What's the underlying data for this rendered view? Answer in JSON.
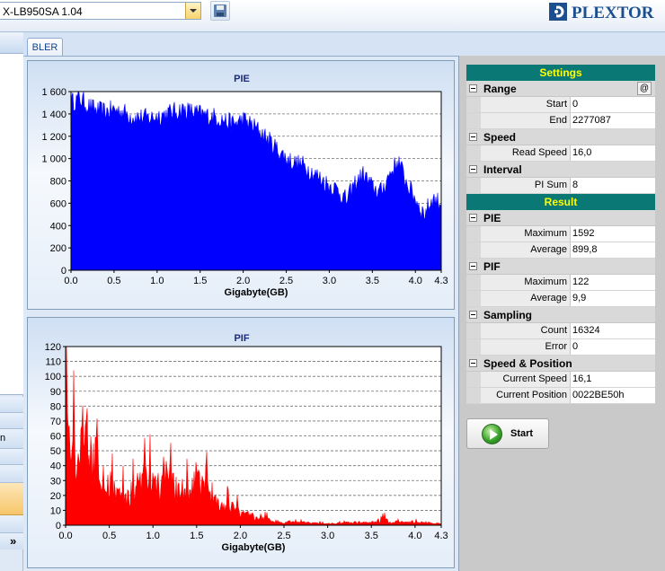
{
  "toolbar": {
    "drive_value": "X-LB950SA 1.04",
    "save_icon": "floppy-disk-icon",
    "brand_text": "PLEXTOR"
  },
  "left_strip": {
    "item_fragment": "n",
    "expand_icon": "double-chevron-right-icon"
  },
  "tabs": [
    {
      "label": "BLER"
    }
  ],
  "charts": {
    "pie_title": "PIE",
    "pif_title": "PIF"
  },
  "chart_data": [
    {
      "type": "area",
      "title": "PIE",
      "xlabel": "Gigabyte(GB)",
      "ylabel": "",
      "xlim": [
        0,
        4.3
      ],
      "ylim": [
        0,
        1600
      ],
      "x_ticks": [
        "0.0",
        "0.5",
        "1.0",
        "1.5",
        "2.0",
        "2.5",
        "3.0",
        "3.5",
        "4.0",
        "4.3"
      ],
      "y_ticks": [
        "0",
        "200",
        "400",
        "600",
        "800",
        "1 000",
        "1 200",
        "1 400",
        "1 600"
      ],
      "x_tick_values": [
        0,
        0.5,
        1.0,
        1.5,
        2.0,
        2.5,
        3.0,
        3.5,
        4.0,
        4.3
      ],
      "y_tick_values": [
        0,
        200,
        400,
        600,
        800,
        1000,
        1200,
        1400,
        1600
      ],
      "grid": "horizontal-dashed",
      "color": "#0000ff",
      "x": [
        0,
        0.1,
        0.2,
        0.3,
        0.4,
        0.5,
        0.6,
        0.7,
        0.8,
        0.9,
        1.0,
        1.1,
        1.2,
        1.3,
        1.4,
        1.5,
        1.6,
        1.7,
        1.8,
        1.9,
        2.0,
        2.1,
        2.2,
        2.3,
        2.4,
        2.5,
        2.6,
        2.7,
        2.8,
        2.9,
        3.0,
        3.1,
        3.2,
        3.3,
        3.4,
        3.5,
        3.6,
        3.7,
        3.8,
        3.9,
        4.0,
        4.1,
        4.2,
        4.3
      ],
      "y": [
        1500,
        1540,
        1470,
        1430,
        1420,
        1440,
        1420,
        1380,
        1370,
        1360,
        1380,
        1400,
        1420,
        1440,
        1420,
        1400,
        1380,
        1370,
        1330,
        1310,
        1350,
        1300,
        1240,
        1160,
        1080,
        1000,
        960,
        940,
        880,
        820,
        760,
        720,
        620,
        780,
        860,
        740,
        700,
        860,
        980,
        780,
        640,
        500,
        640,
        600
      ]
    },
    {
      "type": "area",
      "title": "PIF",
      "xlabel": "Gigabyte(GB)",
      "ylabel": "",
      "xlim": [
        0,
        4.3
      ],
      "ylim": [
        0,
        120
      ],
      "x_ticks": [
        "0.0",
        "0.5",
        "1.0",
        "1.5",
        "2.0",
        "2.5",
        "3.0",
        "3.5",
        "4.0",
        "4.3"
      ],
      "y_ticks": [
        "0",
        "10",
        "20",
        "30",
        "40",
        "50",
        "60",
        "70",
        "80",
        "90",
        "100",
        "110",
        "120"
      ],
      "x_tick_values": [
        0,
        0.5,
        1.0,
        1.5,
        2.0,
        2.5,
        3.0,
        3.5,
        4.0,
        4.3
      ],
      "y_tick_values": [
        0,
        10,
        20,
        30,
        40,
        50,
        60,
        70,
        80,
        90,
        100,
        110,
        120
      ],
      "grid": "horizontal-dashed",
      "color": "#ff0000",
      "x": [
        0,
        0.02,
        0.05,
        0.1,
        0.15,
        0.2,
        0.25,
        0.3,
        0.35,
        0.4,
        0.5,
        0.6,
        0.7,
        0.8,
        0.9,
        1.0,
        1.1,
        1.15,
        1.2,
        1.3,
        1.4,
        1.5,
        1.6,
        1.7,
        1.8,
        1.9,
        2.0,
        2.1,
        2.2,
        2.3,
        2.4,
        2.5,
        2.7,
        3.0,
        3.3,
        3.6,
        3.65,
        3.7,
        3.9,
        4.1,
        4.3
      ],
      "y": [
        20,
        120,
        75,
        45,
        40,
        70,
        60,
        45,
        50,
        40,
        30,
        22,
        20,
        25,
        35,
        30,
        25,
        55,
        28,
        25,
        22,
        30,
        24,
        18,
        12,
        12,
        10,
        7,
        5,
        4,
        3,
        2,
        2,
        1,
        2,
        2,
        7,
        2,
        2,
        2,
        1
      ]
    }
  ],
  "settings": {
    "header": "Settings",
    "range_label": "Range",
    "range_button": "@",
    "start_key": "Start",
    "start_val": "0",
    "end_key": "End",
    "end_val": "2277087",
    "speed_label": "Speed",
    "read_speed_key": "Read Speed",
    "read_speed_val": "16,0",
    "interval_label": "Interval",
    "pisum_key": "PI Sum",
    "pisum_val": "8"
  },
  "result": {
    "header": "Result",
    "pie_label": "PIE",
    "pie_max_key": "Maximum",
    "pie_max_val": "1592",
    "pie_avg_key": "Average",
    "pie_avg_val": "899,8",
    "pif_label": "PIF",
    "pif_max_key": "Maximum",
    "pif_max_val": "122",
    "pif_avg_key": "Average",
    "pif_avg_val": "9,9",
    "sampling_label": "Sampling",
    "count_key": "Count",
    "count_val": "16324",
    "error_key": "Error",
    "error_val": "0",
    "sp_label": "Speed & Position",
    "cur_speed_key": "Current Speed",
    "cur_speed_val": "16,1",
    "cur_pos_key": "Current Position",
    "cur_pos_val": "0022BE50h"
  },
  "start_button": {
    "label": "Start"
  }
}
